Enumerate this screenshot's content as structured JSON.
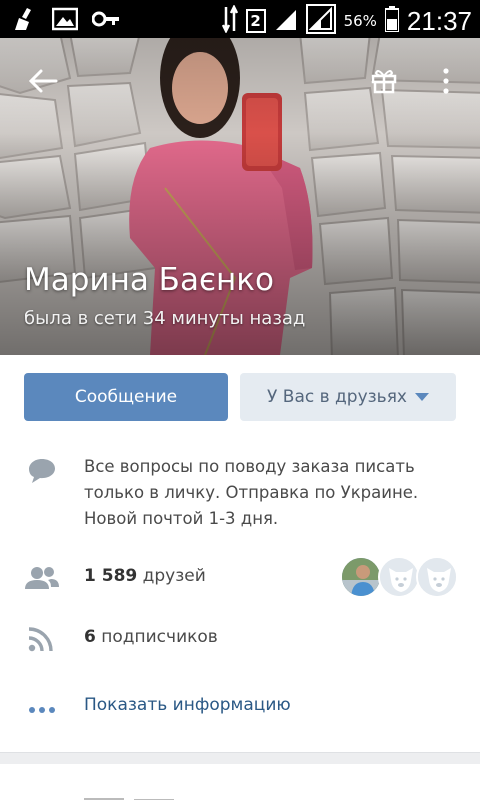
{
  "status_bar": {
    "battery_percent": "56%",
    "time": "21:37",
    "sim_slot": "2",
    "icons": [
      "cleanup-icon",
      "image-icon",
      "key-icon",
      "data-arrows-icon",
      "signal-icon",
      "signal-icon",
      "battery-icon"
    ]
  },
  "header": {
    "name": "Марина Баєнко",
    "last_seen": "была в сети 34 минуты назад"
  },
  "actions": {
    "message_label": "Сообщение",
    "friends_label": "У Вас в друзьях"
  },
  "info": {
    "status": "Все вопросы по поводу заказа писать только в личку. Отправка по Украине. Новой почтой 1-3 дня.",
    "friends_count": "1 589",
    "friends_label": "друзей",
    "followers_count": "6",
    "followers_label": "подписчиков",
    "show_info_label": "Показать информацию"
  },
  "colors": {
    "accent": "#5b88bd",
    "link": "#2a5885",
    "secondary_button": "#e5ebf1",
    "icon_gray": "#9aa4ae"
  }
}
